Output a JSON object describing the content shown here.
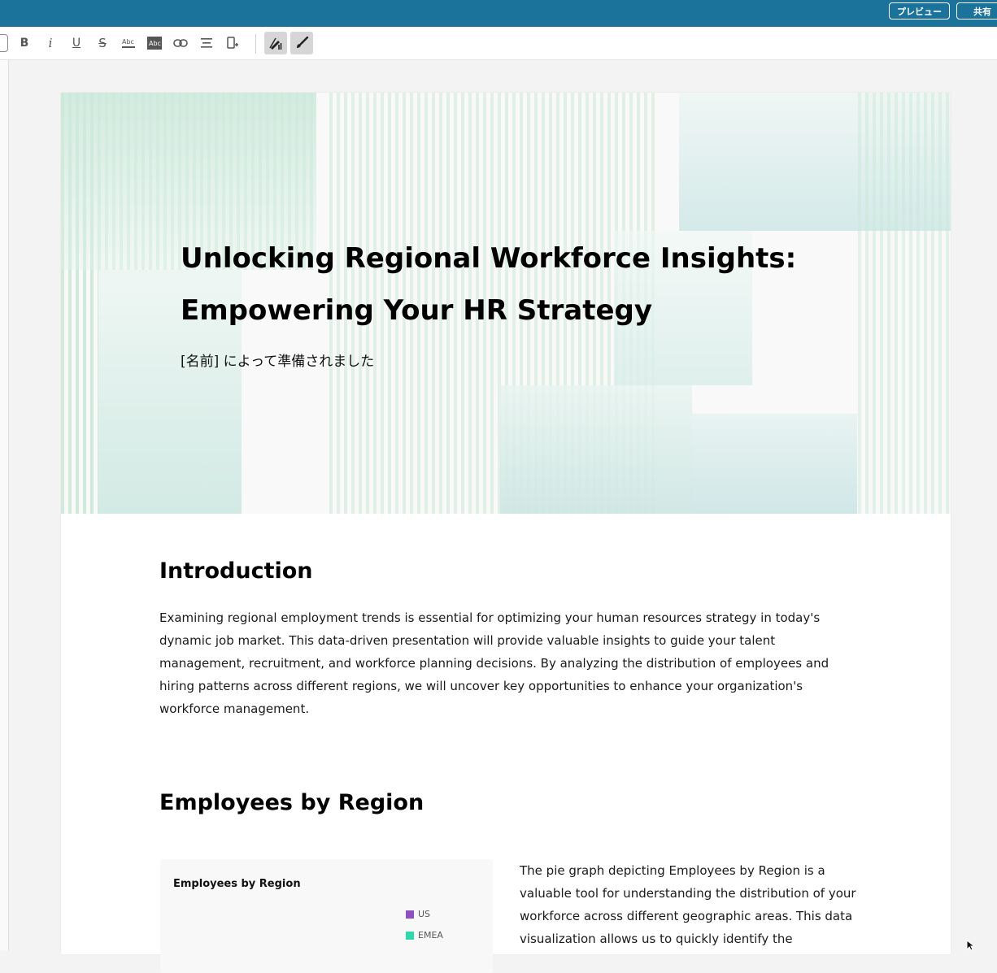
{
  "topbar": {
    "preview_label": "プレビュー",
    "share_label": "共有",
    "bg_color": "#1b739c"
  },
  "toolbar": {
    "buttons": [
      {
        "name": "bold",
        "icon": "bold-icon"
      },
      {
        "name": "italic",
        "icon": "italic-icon"
      },
      {
        "name": "underline",
        "icon": "underline-icon"
      },
      {
        "name": "strikethrough",
        "icon": "strikethrough-icon"
      },
      {
        "name": "text-color",
        "icon": "text-color-icon"
      },
      {
        "name": "highlight",
        "icon": "highlight-icon"
      },
      {
        "name": "link",
        "icon": "link-icon"
      },
      {
        "name": "align",
        "icon": "align-icon"
      },
      {
        "name": "insert",
        "icon": "insert-icon"
      },
      {
        "name": "ai-assist",
        "icon": "sparkle-pen-icon",
        "active": true
      },
      {
        "name": "style-brush",
        "icon": "brush-icon",
        "active": true
      }
    ]
  },
  "cover": {
    "title": "Unlocking Regional Workforce Insights: Empowering Your HR Strategy",
    "subtitle": "[名前] によって準備されました"
  },
  "introduction": {
    "heading": "Introduction",
    "body": "Examining regional employment trends is essential for optimizing your human resources strategy in today's dynamic job market. This data-driven presentation will provide valuable insights to guide your talent management, recruitment, and workforce planning decisions. By analyzing the distribution of employees and hiring patterns across different regions, we will uncover key opportunities to enhance your organization's workforce management."
  },
  "employees_section": {
    "heading": "Employees by Region",
    "body": "The pie graph depicting Employees by Region is a valuable tool for understanding the distribution of your workforce across different geographic areas. This data visualization allows us to quickly identify the"
  },
  "chart_data": {
    "type": "pie",
    "title": "Employees by Region",
    "legend_placement": "right",
    "series": [
      {
        "name": "US",
        "color": "#8e4fc4"
      },
      {
        "name": "EMEA",
        "color": "#2fd8a8"
      }
    ]
  }
}
